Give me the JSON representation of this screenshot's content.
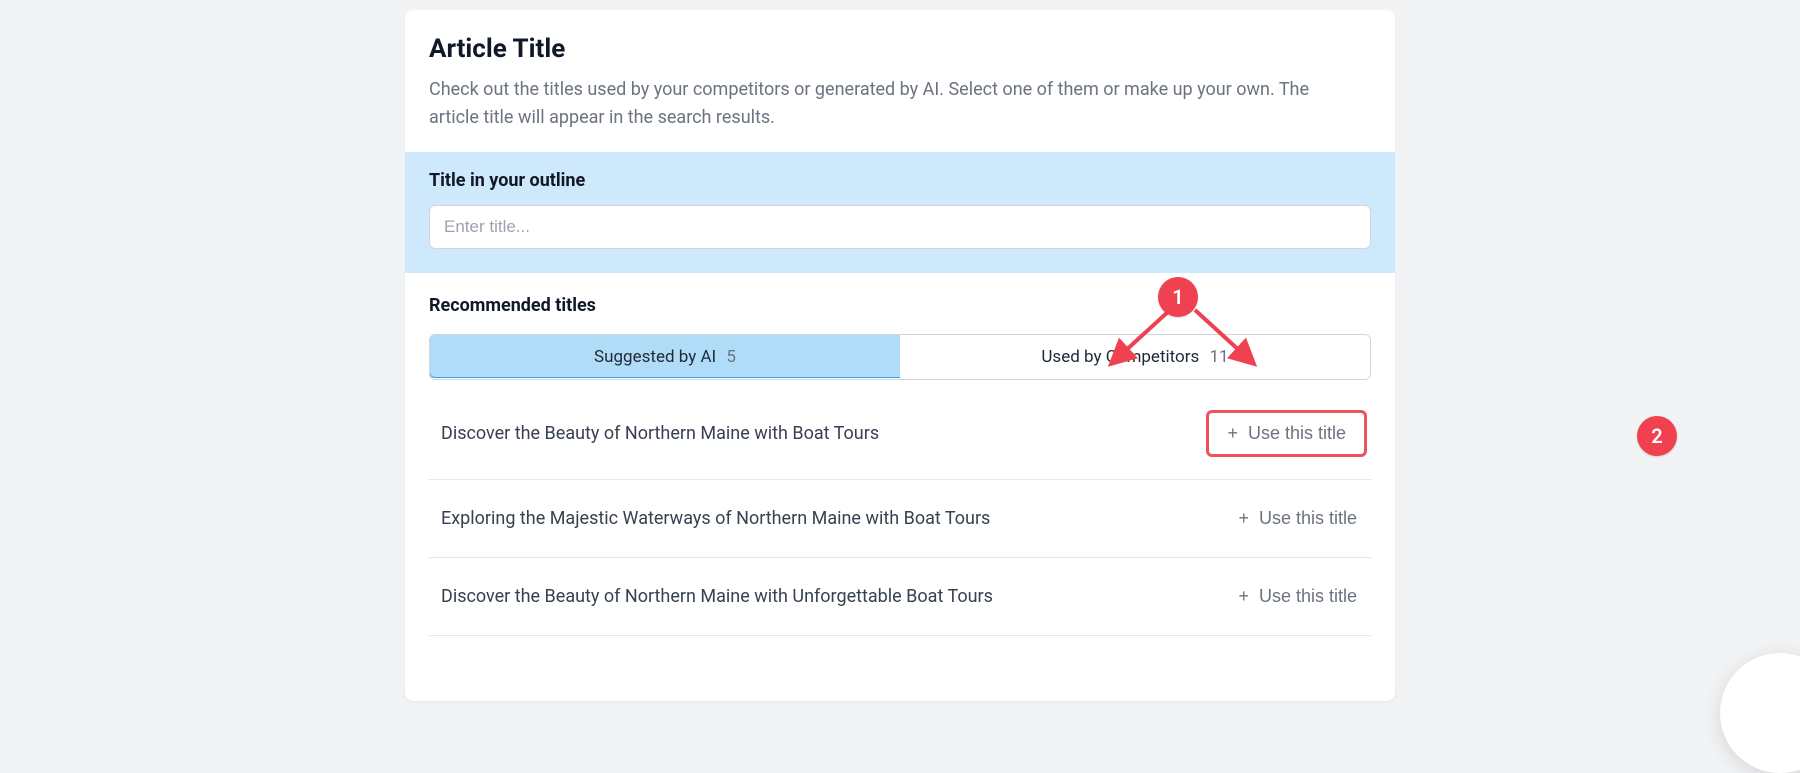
{
  "header": {
    "title": "Article Title",
    "description": "Check out the titles used by your competitors or generated by AI. Select one of them or make up your own. The article title will appear in the search results."
  },
  "outline": {
    "label": "Title in your outline",
    "placeholder": "Enter title..."
  },
  "recommended": {
    "heading": "Recommended titles",
    "tabs": {
      "ai": {
        "label": "Suggested by AI",
        "count": "5",
        "active": true
      },
      "comp": {
        "label": "Used by Competitors",
        "count": "11",
        "active": false
      }
    },
    "use_label": "Use this title",
    "items": [
      "Discover the Beauty of Northern Maine with Boat Tours",
      "Exploring the Majestic Waterways of Northern Maine with Boat Tours",
      "Discover the Beauty of Northern Maine with Unforgettable Boat Tours"
    ]
  },
  "annotations": {
    "badge1": "1",
    "badge2": "2"
  },
  "colors": {
    "accent_annotation": "#ef4150",
    "tab_active_bg": "#b0dcf8",
    "tab_active_border": "#3aa0e3",
    "blue_band_bg": "#cfe9fc"
  }
}
